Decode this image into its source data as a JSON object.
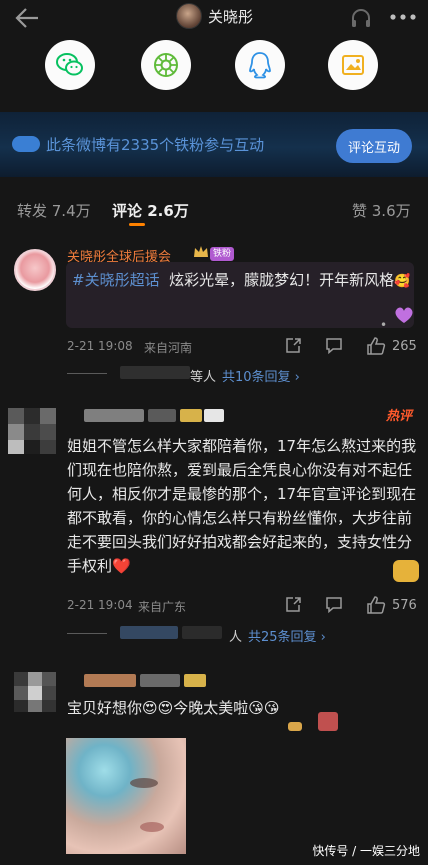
{
  "header": {
    "title": "关晓彤",
    "icons": {
      "back": "back-arrow-icon",
      "headphone": "headphone-icon",
      "more": "more-dots-icon"
    }
  },
  "share": [
    {
      "icon": "wechat-icon",
      "color": "#07c160"
    },
    {
      "icon": "moments-icon",
      "color": "#5fbb3a"
    },
    {
      "icon": "qq-icon",
      "color": "#2e91e5"
    },
    {
      "icon": "qzone-icon",
      "color": "#f0b020"
    }
  ],
  "banner": {
    "text": "此条微博有2335个铁粉参与互动",
    "button": "评论互动"
  },
  "tabs": {
    "repost": "转发 7.4万",
    "comment": "评论 2.6万",
    "like": "赞 3.6万"
  },
  "comments": [
    {
      "username": "关晓彤全球后援会",
      "badge": "铁粉",
      "topic": "#关晓彤超话",
      "text": "炫彩光晕，朦胧梦幻！开年新风格",
      "time": "2-21 19:08",
      "location": "来自河南",
      "likes": "265",
      "reply_prefix": "等人",
      "replies": "共10条回复 ›"
    },
    {
      "badge": "热评",
      "text": "姐姐不管怎么样大家都陪着你，17年怎么熬过来的我们现在也陪你熬，爱到最后全凭良心你没有对不起任何人，相反你才是最惨的那个，17年官宣评论到现在都不敢看，你的心情怎么样只有粉丝懂你，大步往前走不要回头我们好好拍戏都会好起来的，支持女性分手权利❤️",
      "time": "2-21 19:04",
      "location": "来自广东",
      "likes": "576",
      "reply_prefix": "人",
      "replies": "共25条回复 ›"
    },
    {
      "text": "宝贝好想你😍😍今晚太美啦😘😘"
    }
  ],
  "watermark": "快传号 / 一娱三分地",
  "colors": {
    "accent": "#ff8200",
    "link": "#5d8fcf",
    "banner_text": "#5a93d8",
    "username": "#f07c3c"
  }
}
